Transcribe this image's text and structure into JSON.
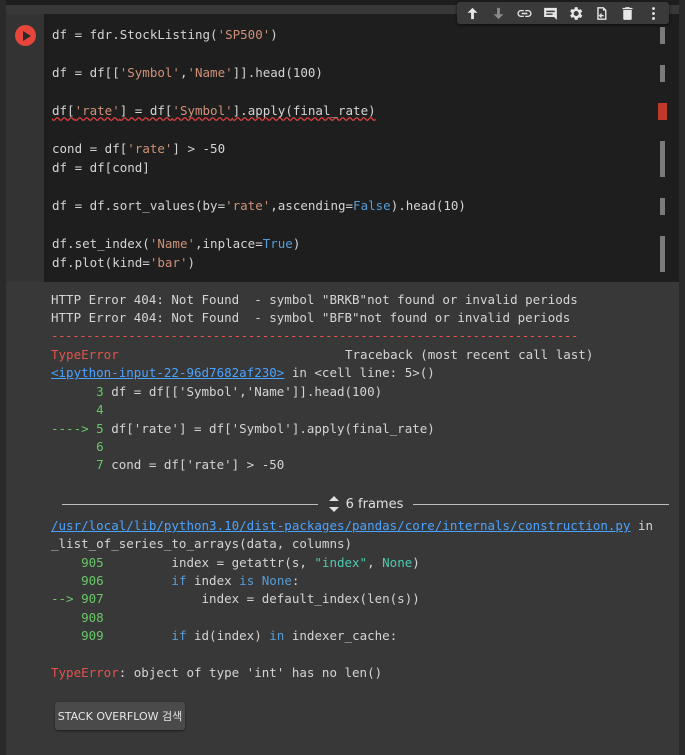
{
  "toolbar": {
    "icons": [
      "arrow-up-icon",
      "arrow-down-icon",
      "link-icon",
      "comment-icon",
      "gear-icon",
      "mirror-cell-icon",
      "trash-icon",
      "more-vert-icon"
    ]
  },
  "code": {
    "l1_a": "df = fdr.StockListing(",
    "l1_s": "'SP500'",
    "l1_b": ")",
    "l2_a": "df = df[[",
    "l2_s1": "'Symbol'",
    "l2_c": ",",
    "l2_s2": "'Name'",
    "l2_b": "]].head(100)",
    "l3_a": "df[",
    "l3_s1": "'rate'",
    "l3_b": "] = df[",
    "l3_s2": "'Symbol'",
    "l3_c": "].apply(final_rate)",
    "l4_a": "cond = df[",
    "l4_s": "'rate'",
    "l4_b": "] > -50",
    "l5": "df = df[cond]",
    "l6_a": "df = df.sort_values(by=",
    "l6_s": "'rate'",
    "l6_b": ",ascending=",
    "l6_k": "False",
    "l6_c": ").head(10)",
    "l7_a": "df.set_index(",
    "l7_s": "'Name'",
    "l7_b": ",inplace=",
    "l7_k": "True",
    "l7_c": ")",
    "l8_a": "df.plot(kind=",
    "l8_s": "'bar'",
    "l8_b": ")"
  },
  "output": {
    "http1": "HTTP Error 404: Not Found  - symbol \"BRKB\"not found or invalid periods",
    "http2": "HTTP Error 404: Not Found  - symbol \"BFB\"not found or invalid periods",
    "dashes": "---------------------------------------------------------------------------",
    "type_error": "TypeError",
    "traceback": "Traceback (most recent call last)",
    "input_link": "<ipython-input-22-96d7682af230>",
    "in_cell": " in <cell line: 5>()",
    "t3_n": "      3",
    "t3_code": " df = df[['Symbol','Name']].head(100)",
    "t4_n": "      4",
    "t5_arrow": "----> 5",
    "t5_code": " df['rate'] = df['Symbol'].apply(final_rate)",
    "t6_n": "      6",
    "t7_n": "      7",
    "t7_code": " cond = df['rate'] > -50",
    "frames_label": "6 frames",
    "path_link": "/usr/local/lib/python3.10/dist-packages/pandas/core/internals/construction.py",
    "path_in": " in",
    "func": "_list_of_series_to_arrays(data, columns)",
    "c905_n": "    905",
    "c905_a": "         index = getattr(s, ",
    "c905_s": "\"index\"",
    "c905_b": ", ",
    "c905_k": "None",
    "c905_c": ")",
    "c906_n": "    906",
    "c906_a": "         ",
    "c906_k1": "if",
    "c906_b": " index ",
    "c906_k2": "is",
    "c906_c": " ",
    "c906_k3": "None",
    "c906_d": ":",
    "c907_arrow": "--> 907",
    "c907_code": "             index = default_index(len(s))",
    "c908_n": "    908",
    "c909_n": "    909",
    "c909_a": "         ",
    "c909_k1": "if",
    "c909_b": " id(index) ",
    "c909_k2": "in",
    "c909_c": " indexer_cache:",
    "final_err": "TypeError",
    "final_msg": ": object of type 'int' has no len()"
  },
  "stack_overflow_label": "STACK OVERFLOW 검색"
}
